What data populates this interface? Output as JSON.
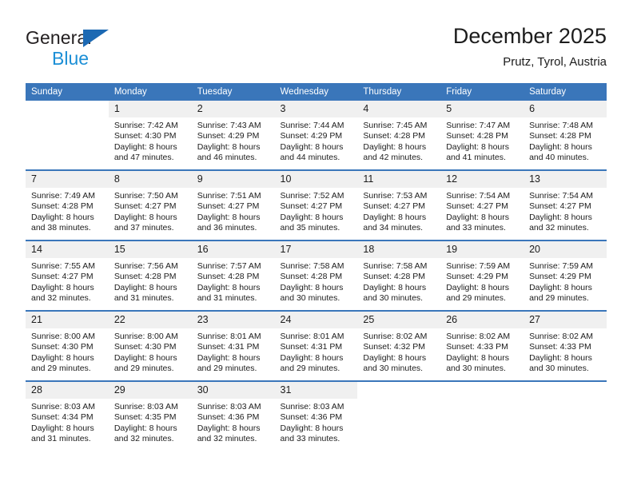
{
  "brand": {
    "line1": "General",
    "line2": "Blue",
    "triangle_color": "#1c69b3",
    "blue_text_color": "#1c8fd6"
  },
  "header": {
    "title": "December 2025",
    "subtitle": "Prutz, Tyrol, Austria"
  },
  "theme": {
    "header_blue": "#3a76ba",
    "daynum_gray": "#f0f0f0",
    "text": "#1c1c1c"
  },
  "weekday_headers": [
    "Sunday",
    "Monday",
    "Tuesday",
    "Wednesday",
    "Thursday",
    "Friday",
    "Saturday"
  ],
  "weeks": [
    [
      {
        "day": "",
        "sunrise": "",
        "sunset": "",
        "daylight1": "",
        "daylight2": "",
        "blank": true
      },
      {
        "day": "1",
        "sunrise": "Sunrise: 7:42 AM",
        "sunset": "Sunset: 4:30 PM",
        "daylight1": "Daylight: 8 hours",
        "daylight2": "and 47 minutes."
      },
      {
        "day": "2",
        "sunrise": "Sunrise: 7:43 AM",
        "sunset": "Sunset: 4:29 PM",
        "daylight1": "Daylight: 8 hours",
        "daylight2": "and 46 minutes."
      },
      {
        "day": "3",
        "sunrise": "Sunrise: 7:44 AM",
        "sunset": "Sunset: 4:29 PM",
        "daylight1": "Daylight: 8 hours",
        "daylight2": "and 44 minutes."
      },
      {
        "day": "4",
        "sunrise": "Sunrise: 7:45 AM",
        "sunset": "Sunset: 4:28 PM",
        "daylight1": "Daylight: 8 hours",
        "daylight2": "and 42 minutes."
      },
      {
        "day": "5",
        "sunrise": "Sunrise: 7:47 AM",
        "sunset": "Sunset: 4:28 PM",
        "daylight1": "Daylight: 8 hours",
        "daylight2": "and 41 minutes."
      },
      {
        "day": "6",
        "sunrise": "Sunrise: 7:48 AM",
        "sunset": "Sunset: 4:28 PM",
        "daylight1": "Daylight: 8 hours",
        "daylight2": "and 40 minutes."
      }
    ],
    [
      {
        "day": "7",
        "sunrise": "Sunrise: 7:49 AM",
        "sunset": "Sunset: 4:28 PM",
        "daylight1": "Daylight: 8 hours",
        "daylight2": "and 38 minutes."
      },
      {
        "day": "8",
        "sunrise": "Sunrise: 7:50 AM",
        "sunset": "Sunset: 4:27 PM",
        "daylight1": "Daylight: 8 hours",
        "daylight2": "and 37 minutes."
      },
      {
        "day": "9",
        "sunrise": "Sunrise: 7:51 AM",
        "sunset": "Sunset: 4:27 PM",
        "daylight1": "Daylight: 8 hours",
        "daylight2": "and 36 minutes."
      },
      {
        "day": "10",
        "sunrise": "Sunrise: 7:52 AM",
        "sunset": "Sunset: 4:27 PM",
        "daylight1": "Daylight: 8 hours",
        "daylight2": "and 35 minutes."
      },
      {
        "day": "11",
        "sunrise": "Sunrise: 7:53 AM",
        "sunset": "Sunset: 4:27 PM",
        "daylight1": "Daylight: 8 hours",
        "daylight2": "and 34 minutes."
      },
      {
        "day": "12",
        "sunrise": "Sunrise: 7:54 AM",
        "sunset": "Sunset: 4:27 PM",
        "daylight1": "Daylight: 8 hours",
        "daylight2": "and 33 minutes."
      },
      {
        "day": "13",
        "sunrise": "Sunrise: 7:54 AM",
        "sunset": "Sunset: 4:27 PM",
        "daylight1": "Daylight: 8 hours",
        "daylight2": "and 32 minutes."
      }
    ],
    [
      {
        "day": "14",
        "sunrise": "Sunrise: 7:55 AM",
        "sunset": "Sunset: 4:27 PM",
        "daylight1": "Daylight: 8 hours",
        "daylight2": "and 32 minutes."
      },
      {
        "day": "15",
        "sunrise": "Sunrise: 7:56 AM",
        "sunset": "Sunset: 4:28 PM",
        "daylight1": "Daylight: 8 hours",
        "daylight2": "and 31 minutes."
      },
      {
        "day": "16",
        "sunrise": "Sunrise: 7:57 AM",
        "sunset": "Sunset: 4:28 PM",
        "daylight1": "Daylight: 8 hours",
        "daylight2": "and 31 minutes."
      },
      {
        "day": "17",
        "sunrise": "Sunrise: 7:58 AM",
        "sunset": "Sunset: 4:28 PM",
        "daylight1": "Daylight: 8 hours",
        "daylight2": "and 30 minutes."
      },
      {
        "day": "18",
        "sunrise": "Sunrise: 7:58 AM",
        "sunset": "Sunset: 4:28 PM",
        "daylight1": "Daylight: 8 hours",
        "daylight2": "and 30 minutes."
      },
      {
        "day": "19",
        "sunrise": "Sunrise: 7:59 AM",
        "sunset": "Sunset: 4:29 PM",
        "daylight1": "Daylight: 8 hours",
        "daylight2": "and 29 minutes."
      },
      {
        "day": "20",
        "sunrise": "Sunrise: 7:59 AM",
        "sunset": "Sunset: 4:29 PM",
        "daylight1": "Daylight: 8 hours",
        "daylight2": "and 29 minutes."
      }
    ],
    [
      {
        "day": "21",
        "sunrise": "Sunrise: 8:00 AM",
        "sunset": "Sunset: 4:30 PM",
        "daylight1": "Daylight: 8 hours",
        "daylight2": "and 29 minutes."
      },
      {
        "day": "22",
        "sunrise": "Sunrise: 8:00 AM",
        "sunset": "Sunset: 4:30 PM",
        "daylight1": "Daylight: 8 hours",
        "daylight2": "and 29 minutes."
      },
      {
        "day": "23",
        "sunrise": "Sunrise: 8:01 AM",
        "sunset": "Sunset: 4:31 PM",
        "daylight1": "Daylight: 8 hours",
        "daylight2": "and 29 minutes."
      },
      {
        "day": "24",
        "sunrise": "Sunrise: 8:01 AM",
        "sunset": "Sunset: 4:31 PM",
        "daylight1": "Daylight: 8 hours",
        "daylight2": "and 29 minutes."
      },
      {
        "day": "25",
        "sunrise": "Sunrise: 8:02 AM",
        "sunset": "Sunset: 4:32 PM",
        "daylight1": "Daylight: 8 hours",
        "daylight2": "and 30 minutes."
      },
      {
        "day": "26",
        "sunrise": "Sunrise: 8:02 AM",
        "sunset": "Sunset: 4:33 PM",
        "daylight1": "Daylight: 8 hours",
        "daylight2": "and 30 minutes."
      },
      {
        "day": "27",
        "sunrise": "Sunrise: 8:02 AM",
        "sunset": "Sunset: 4:33 PM",
        "daylight1": "Daylight: 8 hours",
        "daylight2": "and 30 minutes."
      }
    ],
    [
      {
        "day": "28",
        "sunrise": "Sunrise: 8:03 AM",
        "sunset": "Sunset: 4:34 PM",
        "daylight1": "Daylight: 8 hours",
        "daylight2": "and 31 minutes."
      },
      {
        "day": "29",
        "sunrise": "Sunrise: 8:03 AM",
        "sunset": "Sunset: 4:35 PM",
        "daylight1": "Daylight: 8 hours",
        "daylight2": "and 32 minutes."
      },
      {
        "day": "30",
        "sunrise": "Sunrise: 8:03 AM",
        "sunset": "Sunset: 4:36 PM",
        "daylight1": "Daylight: 8 hours",
        "daylight2": "and 32 minutes."
      },
      {
        "day": "31",
        "sunrise": "Sunrise: 8:03 AM",
        "sunset": "Sunset: 4:36 PM",
        "daylight1": "Daylight: 8 hours",
        "daylight2": "and 33 minutes."
      },
      {
        "day": "",
        "sunrise": "",
        "sunset": "",
        "daylight1": "",
        "daylight2": "",
        "blank": true
      },
      {
        "day": "",
        "sunrise": "",
        "sunset": "",
        "daylight1": "",
        "daylight2": "",
        "blank": true
      },
      {
        "day": "",
        "sunrise": "",
        "sunset": "",
        "daylight1": "",
        "daylight2": "",
        "blank": true
      }
    ]
  ]
}
